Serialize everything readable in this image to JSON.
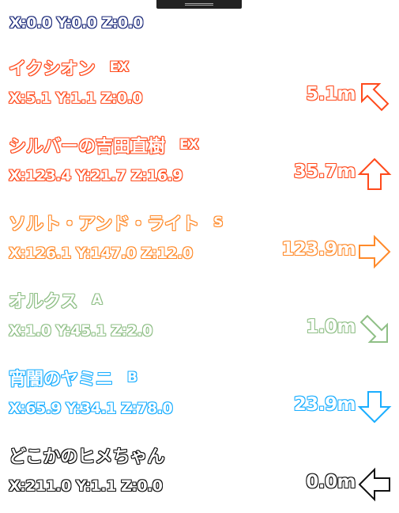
{
  "player_position": {
    "text": "X:0.0 Y:0.0 Z:0.0",
    "color": "#1c2a7a"
  },
  "entries": [
    {
      "name": "イクシオン",
      "rank": "EX",
      "coords": "X:5.1 Y:1.1 Z:0.0",
      "distance": "5.1m",
      "direction_icon": "arrow-up-left-icon",
      "color": "#ff4a1c"
    },
    {
      "name": "シルバーの吉田直樹",
      "rank": "EX",
      "coords": "X:123.4 Y:21.7 Z:16.9",
      "distance": "35.7m",
      "direction_icon": "arrow-up-icon",
      "color": "#ff4a1c"
    },
    {
      "name": "ソルト・アンド・ライト",
      "rank": "S",
      "coords": "X:126.1 Y:147.0 Z:12.0",
      "distance": "123.9m",
      "direction_icon": "arrow-right-icon",
      "color": "#ff8a2a"
    },
    {
      "name": "オルクス",
      "rank": "A",
      "coords": "X:1.0 Y:45.1 Z:2.0",
      "distance": "1.0m",
      "direction_icon": "arrow-down-right-icon",
      "color": "#8fbf86"
    },
    {
      "name": "宵闇のヤミニ",
      "rank": "B",
      "coords": "X:65.9 Y:34.1 Z:78.0",
      "distance": "23.9m",
      "direction_icon": "arrow-down-icon",
      "color": "#1aaeff"
    },
    {
      "name": "どこかのヒメちゃん",
      "rank": "",
      "coords": "X:211.0 Y:1.1 Z:0.0",
      "distance": "0.0m",
      "direction_icon": "arrow-left-icon",
      "color": "#111111"
    }
  ]
}
